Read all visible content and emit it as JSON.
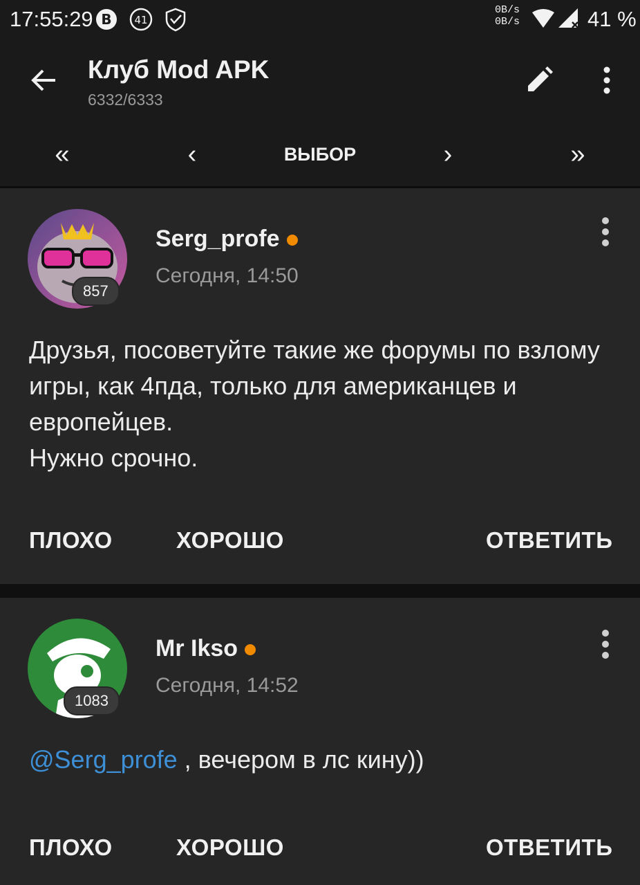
{
  "status_bar": {
    "time": "17:55:29",
    "net_up": "0B/s",
    "net_down": "0B/s",
    "battery": "41 %"
  },
  "header": {
    "title": "Клуб Mod APK",
    "subtitle": "6332/6333"
  },
  "pager": {
    "first": "«",
    "prev": "‹",
    "select": "ВЫБОР",
    "next": "›",
    "last": "»"
  },
  "posts": [
    {
      "author": "Serg_profe",
      "date": "Сегодня, 14:50",
      "reputation": "857",
      "text": "Друзья, посоветуйте такие же форумы по взлому игры, как 4пда, только для американцев и европейцев.\nНужно срочно.",
      "actions": {
        "bad": "ПЛОХО",
        "good": "ХОРОШО",
        "reply": "ОТВЕТИТЬ"
      }
    },
    {
      "author": "Mr Ikso",
      "date": "Сегодня, 14:52",
      "reputation": "1083",
      "mention": "@Serg_profe",
      "text": " , вечером в лс кину))",
      "actions": {
        "bad": "ПЛОХО",
        "good": "ХОРОШО",
        "reply": "ОТВЕТИТЬ"
      }
    }
  ],
  "colors": {
    "background": "#1a1a1a",
    "card": "#262626",
    "online_dot": "#f08a00",
    "mention": "#3d8fd6"
  },
  "icons": [
    "b-circle-icon",
    "notification-count-icon",
    "vpn-shield-icon",
    "wifi-icon",
    "signal-icon",
    "back-arrow-icon",
    "pencil-icon",
    "more-vert-icon"
  ]
}
